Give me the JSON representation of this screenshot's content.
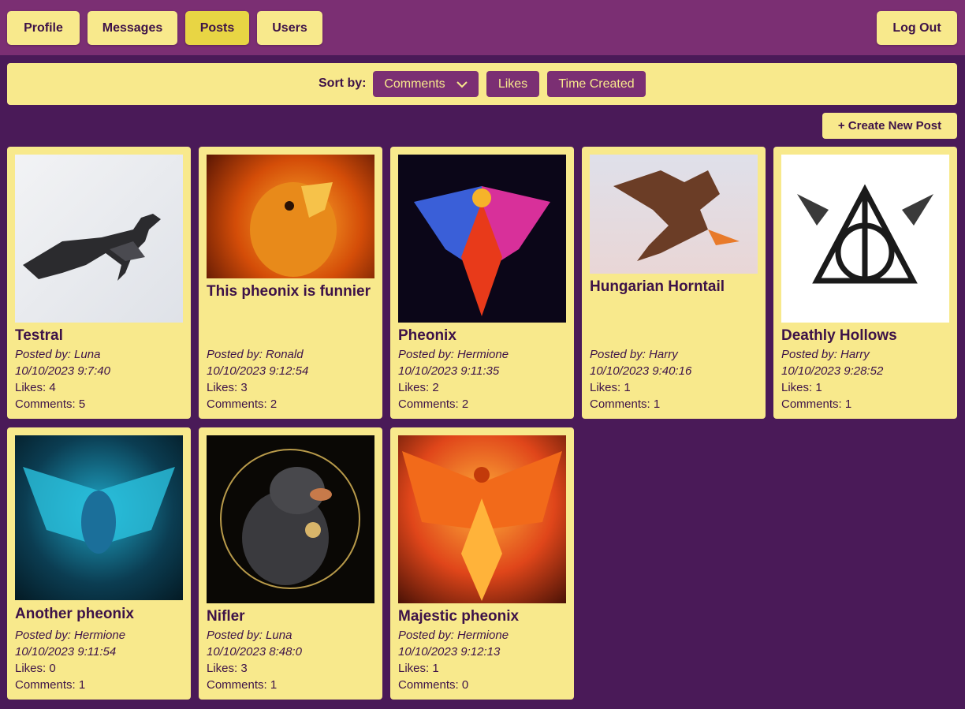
{
  "nav": {
    "profile": "Profile",
    "messages": "Messages",
    "posts": "Posts",
    "users": "Users",
    "logout": "Log Out"
  },
  "sort": {
    "label": "Sort by:",
    "comments": "Comments",
    "likes": "Likes",
    "time_created": "Time Created"
  },
  "create_post": "+ Create New Post",
  "colors": {
    "background": "#4a1a58",
    "topbar": "#7b2f73",
    "card": "#f8e98c",
    "active_nav": "#e8d544",
    "text": "#3d1248"
  },
  "posts": [
    {
      "title": "Testral",
      "author": "Posted by: Luna",
      "time": "10/10/2023 9:7:40",
      "likes": "Likes: 4",
      "comments": "Comments: 5",
      "image": "thestral-image"
    },
    {
      "title": "This pheonix is funnier",
      "author": "Posted by: Ronald",
      "time": "10/10/2023 9:12:54",
      "likes": "Likes: 3",
      "comments": "Comments: 2",
      "image": "fire-eagle-image"
    },
    {
      "title": "Pheonix",
      "author": "Posted by: Hermione",
      "time": "10/10/2023 9:11:35",
      "likes": "Likes: 2",
      "comments": "Comments: 2",
      "image": "colorful-phoenix-image"
    },
    {
      "title": "Hungarian Horntail",
      "author": "Posted by: Harry",
      "time": "10/10/2023 9:40:16",
      "likes": "Likes: 1",
      "comments": "Comments: 1",
      "image": "dragon-image"
    },
    {
      "title": "Deathly Hollows",
      "author": "Posted by: Harry",
      "time": "10/10/2023 9:28:52",
      "likes": "Likes: 1",
      "comments": "Comments: 1",
      "image": "deathly-hallows-image"
    },
    {
      "title": "Another pheonix",
      "author": "Posted by: Hermione",
      "time": "10/10/2023 9:11:54",
      "likes": "Likes: 0",
      "comments": "Comments: 1",
      "image": "blue-phoenix-image"
    },
    {
      "title": "Nifler",
      "author": "Posted by: Luna",
      "time": "10/10/2023 8:48:0",
      "likes": "Likes: 3",
      "comments": "Comments: 1",
      "image": "niffler-image"
    },
    {
      "title": "Majestic pheonix",
      "author": "Posted by: Hermione",
      "time": "10/10/2023 9:12:13",
      "likes": "Likes: 1",
      "comments": "Comments: 0",
      "image": "fire-phoenix-image"
    }
  ]
}
